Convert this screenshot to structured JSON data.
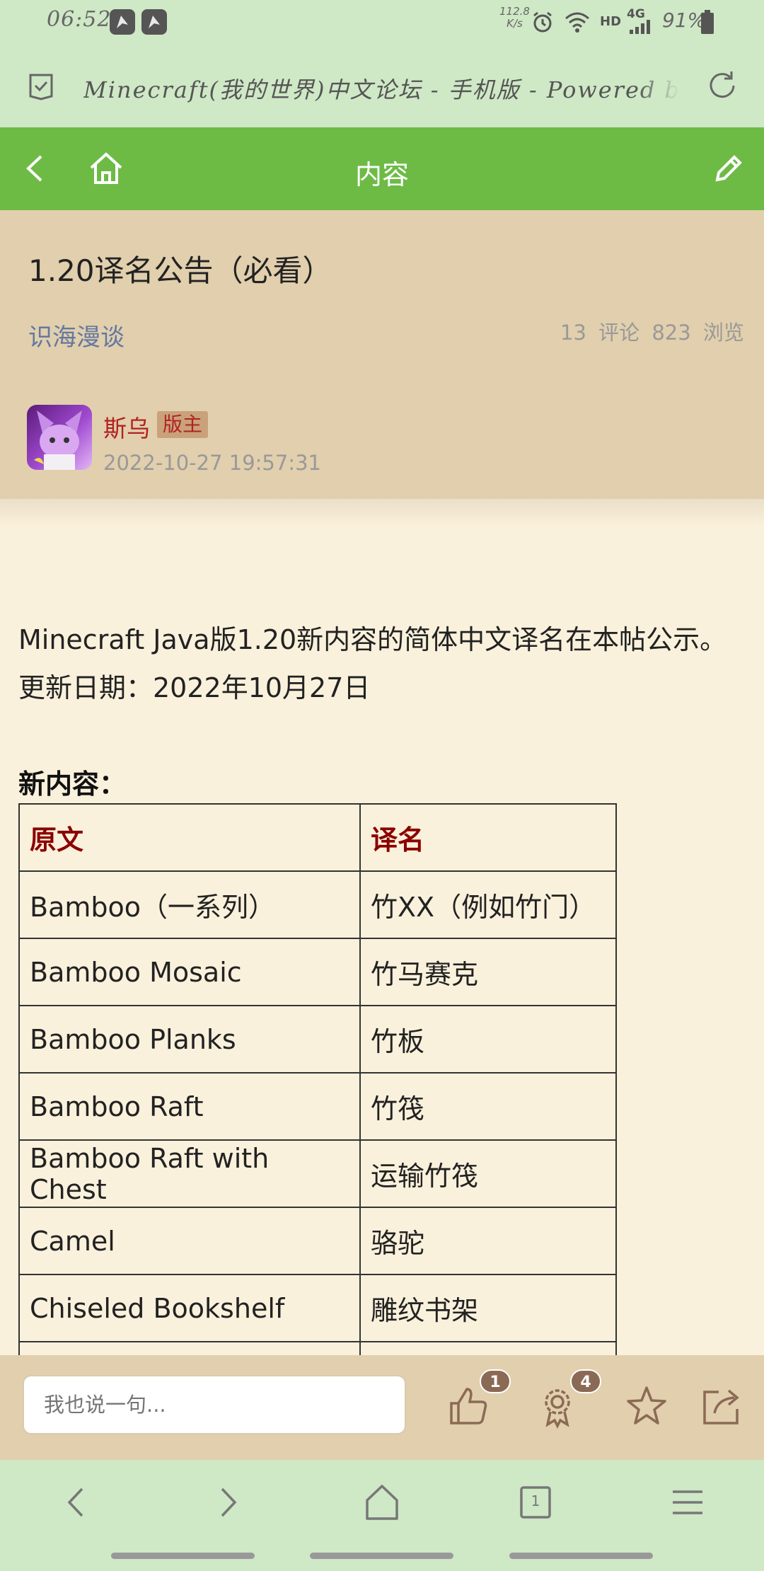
{
  "status_bar": {
    "time": "06:52",
    "net_speed_value": "112.8",
    "net_speed_unit": "K/s",
    "hd": "HD",
    "network": "4G",
    "battery": "91%"
  },
  "browser": {
    "url_title": "Minecraft(我的世界)中文论坛 - 手机版 - Powered by"
  },
  "header": {
    "title": "内容"
  },
  "post": {
    "title": "1.20译名公告（必看）",
    "forum": "识海漫谈",
    "comments": "13 评论",
    "views": "823 浏览",
    "author": "斯乌",
    "author_badge": "版主",
    "date": "2022-10-27 19:57:31",
    "intro": "Minecraft Java版1.20新内容的简体中文译名在本帖公示。更新日期：2022年10月27日",
    "section_title": "新内容：",
    "table": {
      "headers": [
        "原文",
        "译名"
      ],
      "rows": [
        [
          "Bamboo（一系列）",
          "竹XX（例如竹门）"
        ],
        [
          "Bamboo Mosaic",
          "竹马赛克"
        ],
        [
          "Bamboo Planks",
          "竹板"
        ],
        [
          "Bamboo Raft",
          "竹筏"
        ],
        [
          "Bamboo Raft with Chest",
          "运输竹筏"
        ],
        [
          "Camel",
          "骆驼"
        ],
        [
          "Chiseled Bookshelf",
          "雕纹书架"
        ],
        [
          "",
          ""
        ]
      ]
    }
  },
  "comment_bar": {
    "placeholder": "我也说一句...",
    "like_count": "1",
    "award_count": "4"
  },
  "nav": {
    "tab_count": "1"
  }
}
